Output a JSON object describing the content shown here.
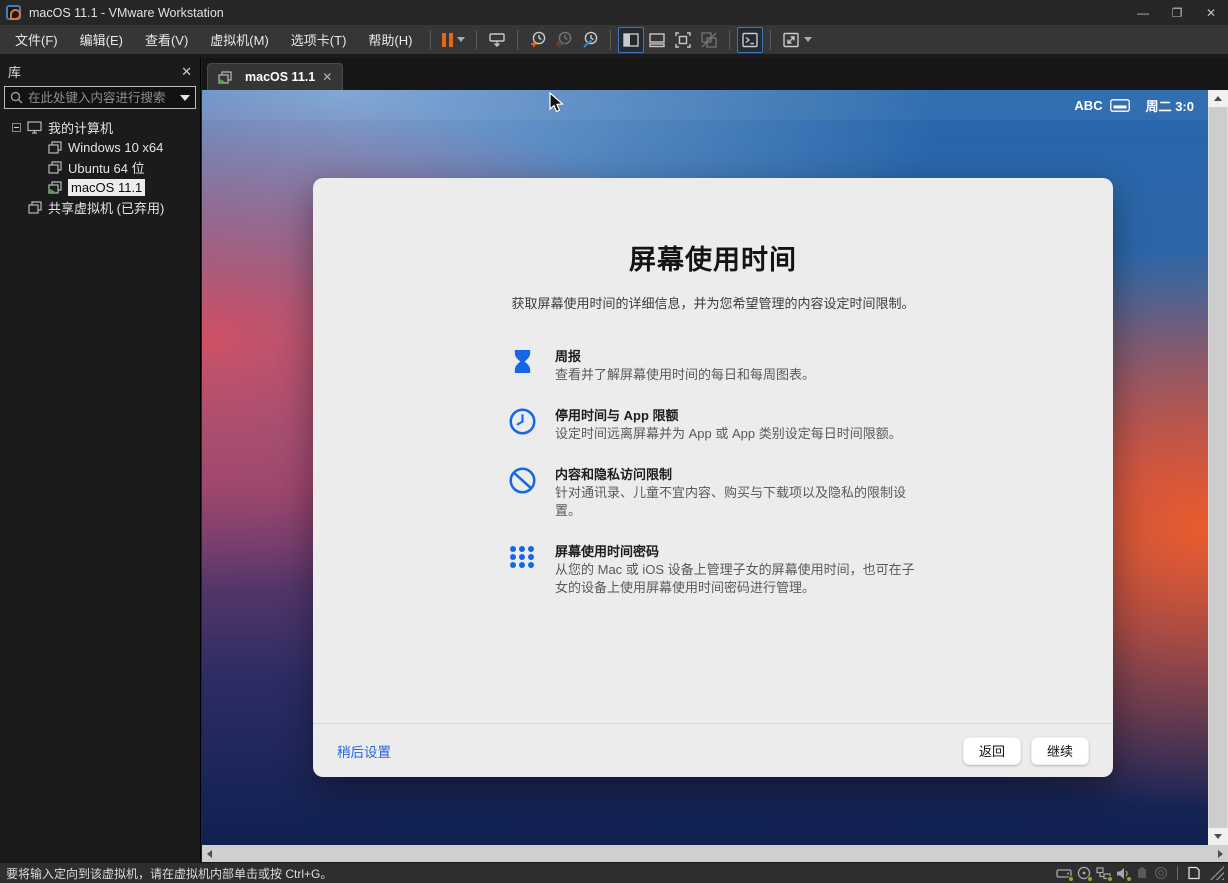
{
  "window": {
    "title": "macOS 11.1 - VMware Workstation",
    "controls": {
      "minimize": "—",
      "maximize": "❐",
      "close": "✕"
    }
  },
  "menubar": {
    "items": [
      {
        "label": "文件(F)"
      },
      {
        "label": "编辑(E)"
      },
      {
        "label": "查看(V)"
      },
      {
        "label": "虚拟机(M)"
      },
      {
        "label": "选项卡(T)"
      },
      {
        "label": "帮助(H)"
      }
    ]
  },
  "toolbar": {
    "icons": [
      "pause-vm",
      "send-ctrl-alt-del",
      "take-snapshot",
      "revert-snapshot",
      "manage-snapshots",
      "show-library",
      "show-thumbnail-bar",
      "fullscreen",
      "unity-mode",
      "console-view",
      "stretch-guest"
    ]
  },
  "sidebar": {
    "header_label": "库",
    "close_glyph": "✕",
    "search_placeholder": "在此处键入内容进行搜索",
    "tree": [
      {
        "label": "我的计算机",
        "type": "computer"
      },
      {
        "label": "Windows 10 x64",
        "type": "vm"
      },
      {
        "label": "Ubuntu 64 位",
        "type": "vm"
      },
      {
        "label": "macOS 11.1",
        "type": "vm-running",
        "selected": true
      },
      {
        "label": "共享虚拟机 (已弃用)",
        "type": "shared"
      }
    ]
  },
  "tabbar": {
    "tabs": [
      {
        "label": "macOS 11.1",
        "close_glyph": "✕"
      }
    ]
  },
  "vm": {
    "menubar": {
      "input_source": "ABC",
      "clock": "周二 3:0"
    },
    "dialog": {
      "title": "屏幕使用时间",
      "subtitle": "获取屏幕使用时间的详细信息，并为您希望管理的内容设定时间限制。",
      "features": [
        {
          "icon": "hourglass-icon",
          "title": "周报",
          "desc": "查看并了解屏幕使用时间的每日和每周图表。"
        },
        {
          "icon": "clock-icon",
          "title": "停用时间与 App 限额",
          "desc": "设定时间远离屏幕并为 App 或 App 类别设定每日时间限额。"
        },
        {
          "icon": "prohibit-icon",
          "title": "内容和隐私访问限制",
          "desc": "针对通讯录、儿童不宜内容、购买与下载项以及隐私的限制设置。"
        },
        {
          "icon": "passcode-dots-icon",
          "title": "屏幕使用时间密码",
          "desc": "从您的 Mac 或 iOS 设备上管理子女的屏幕使用时间，也可在子女的设备上使用屏幕使用时间密码进行管理。"
        }
      ],
      "later_label": "稍后设置",
      "back_label": "返回",
      "continue_label": "继续"
    }
  },
  "statusbar": {
    "message": "要将输入定向到该虚拟机，请在虚拟机内部单击或按 Ctrl+G。",
    "icons": [
      "harddisk",
      "cdrom",
      "network",
      "sound",
      "usb",
      "printer",
      "notifications"
    ]
  },
  "colors": {
    "macos_accent_blue": "#1666e8",
    "vmware_orange": "#e8641b",
    "toolbar_active_border": "#3d74b8",
    "status_green": "#76b82a",
    "dialog_bg": "#ececec"
  }
}
